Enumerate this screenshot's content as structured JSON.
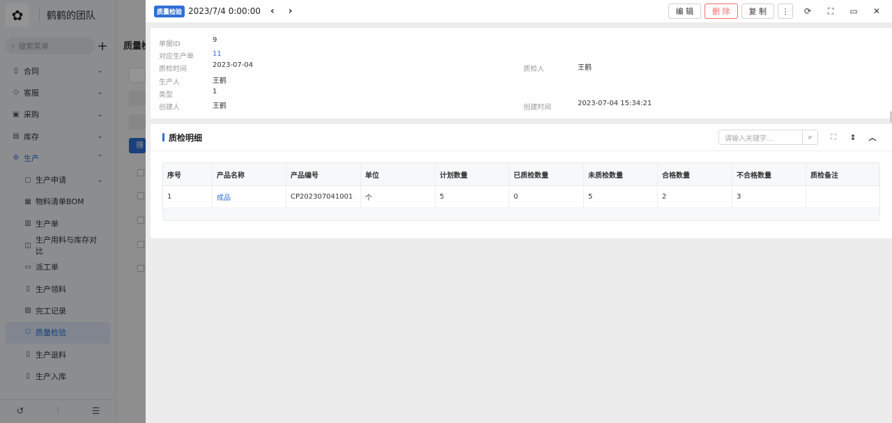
{
  "sidebar": {
    "team_name": "鹤鹤的团队",
    "search_placeholder": "搜索菜单",
    "menu": [
      {
        "label": "合同",
        "icon": "contract-icon",
        "chevron": "⌄"
      },
      {
        "label": "客服",
        "icon": "service-icon",
        "chevron": "⌄"
      },
      {
        "label": "采购",
        "icon": "purchase-icon",
        "chevron": "⌄"
      },
      {
        "label": "库存",
        "icon": "inventory-icon",
        "chevron": "⌄"
      },
      {
        "label": "生产",
        "icon": "production-icon",
        "chevron": "⌃"
      }
    ],
    "submenu": [
      {
        "label": "生产申请",
        "icon": "apply-icon",
        "chevron": "⌄"
      },
      {
        "label": "物料清单BOM",
        "icon": "bom-icon"
      },
      {
        "label": "生产单",
        "icon": "order-icon"
      },
      {
        "label": "生产用料与库存对比",
        "icon": "compare-icon"
      },
      {
        "label": "派工单",
        "icon": "dispatch-icon"
      },
      {
        "label": "生产领料",
        "icon": "pick-icon"
      },
      {
        "label": "完工记录",
        "icon": "finish-icon"
      },
      {
        "label": "质量检验",
        "icon": "shield-icon"
      },
      {
        "label": "生产退料",
        "icon": "return-icon"
      },
      {
        "label": "生产入库",
        "icon": "stockin-icon"
      }
    ]
  },
  "background_page": {
    "title": "质量检",
    "blue_btn": "筛"
  },
  "drawer": {
    "tag": "质量检验",
    "title": "2023/7/4 0:00:00",
    "actions": {
      "edit": "编 辑",
      "delete": "删 除",
      "copy": "复 制"
    },
    "info": {
      "id_label": "单据ID",
      "id_value": "9",
      "order_label": "对应生产单",
      "order_value": "11",
      "time_label": "质检时间",
      "time_value": "2023-07-04",
      "producer_label": "生产人",
      "producer_value": "王鹤",
      "type_label": "类型",
      "type_value": "1",
      "creator_label": "创建人",
      "creator_value": "王鹤",
      "inspector_label": "质检人",
      "inspector_value": "王鹤",
      "created_label": "创建时间",
      "created_value": "2023-07-04 15:34:21"
    },
    "detail": {
      "title": "质检明细",
      "search_placeholder": "请输入关键字...",
      "columns": [
        "序号",
        "产品名称",
        "产品编号",
        "单位",
        "计划数量",
        "已质检数量",
        "未质检数量",
        "合格数量",
        "不合格数量",
        "质检备注"
      ],
      "rows": [
        [
          "1",
          "成品",
          "CP202307041001",
          "个",
          "5",
          "0",
          "5",
          "2",
          "3",
          ""
        ]
      ]
    }
  },
  "colors": {
    "accent": "#2f6fd6",
    "danger": "#f56c6c"
  }
}
